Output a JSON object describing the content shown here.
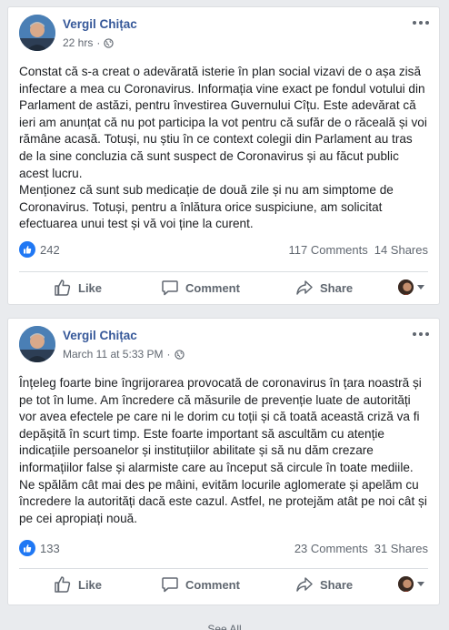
{
  "posts": [
    {
      "author": "Vergil Chițac",
      "time": "22 hrs",
      "text": "Constat că s-a creat o adevărată isterie în plan social vizavi de o așa zisă infectare a mea cu Coronavirus. Informația vine exact pe fondul votului din Parlament de astăzi, pentru învestirea Guvernului Cîțu. Este adevărat că ieri am anunțat că nu pot participa la vot pentru că sufăr de o răceală și voi rămâne acasă. Totuși, nu știu în ce context colegii din Parlament au tras de la sine concluzia că sunt suspect de Coronavirus și au făcut public acest lucru.\nMenționez că sunt sub medicație de două zile și nu am simptome de Coronavirus. Totuși, pentru a înlătura orice suspiciune, am solicitat efectuarea unui test și vă voi ține la curent.",
      "reactions": "242",
      "comments": "117 Comments",
      "shares": "14 Shares"
    },
    {
      "author": "Vergil Chițac",
      "time": "March 11 at 5:33 PM",
      "text": "Înțeleg foarte bine îngrijorarea provocată de coronavirus în țara noastră și pe tot în lume. Am încredere că măsurile de prevenție luate de autorități vor avea efectele pe care ni le dorim cu toții și că toată această criză va fi depășită în scurt timp. Este foarte important să ascultăm cu atenție indicațiile persoanelor și instituțiilor abilitate și să nu dăm crezare informațiilor false și alarmiste care au început să circule în toate mediile. Ne spălăm cât mai des pe mâini, evităm locurile aglomerate și apelăm cu încredere la autorități dacă este cazul. Astfel, ne protejăm atât pe noi cât și pe cei apropiați nouă.",
      "reactions": "133",
      "comments": "23 Comments",
      "shares": "31 Shares"
    }
  ],
  "actions": {
    "like": "Like",
    "comment": "Comment",
    "share": "Share"
  },
  "footer": {
    "see_all": "See All"
  },
  "colors": {
    "link": "#365899",
    "like_blue": "#2078f4",
    "muted": "#606770"
  }
}
